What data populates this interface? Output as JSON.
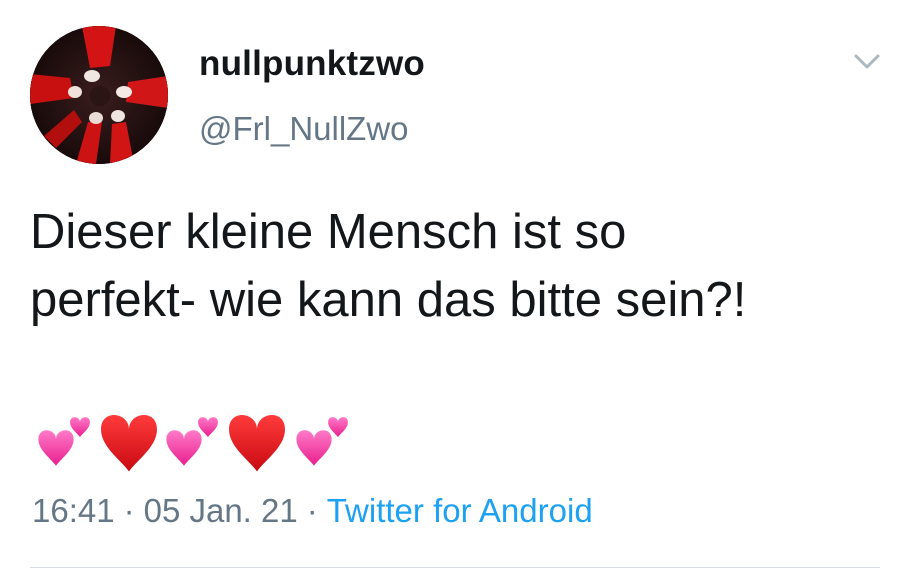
{
  "user": {
    "display_name": "nullpunktzwo",
    "handle": "@Frl_NullZwo",
    "avatar_icon": "profile-photo-red-legs"
  },
  "menu": {
    "icon": "chevron-down-icon"
  },
  "tweet": {
    "text_lines": [
      "Dieser kleine Mensch ist so",
      "perfekt- wie kann das bitte sein?!"
    ],
    "emojis": [
      "two-hearts-icon",
      "red-heart-icon",
      "two-hearts-icon",
      "red-heart-icon",
      "two-hearts-icon"
    ]
  },
  "meta": {
    "time": "16:41",
    "separator": "·",
    "date": "05 Jan. 21",
    "source": "Twitter for Android"
  },
  "colors": {
    "text_primary": "#14171a",
    "text_secondary": "#657786",
    "link": "#1da1f2",
    "heart_red": "#e0141e",
    "heart_pink": "#f43ea7",
    "divider": "#d7dde2"
  }
}
